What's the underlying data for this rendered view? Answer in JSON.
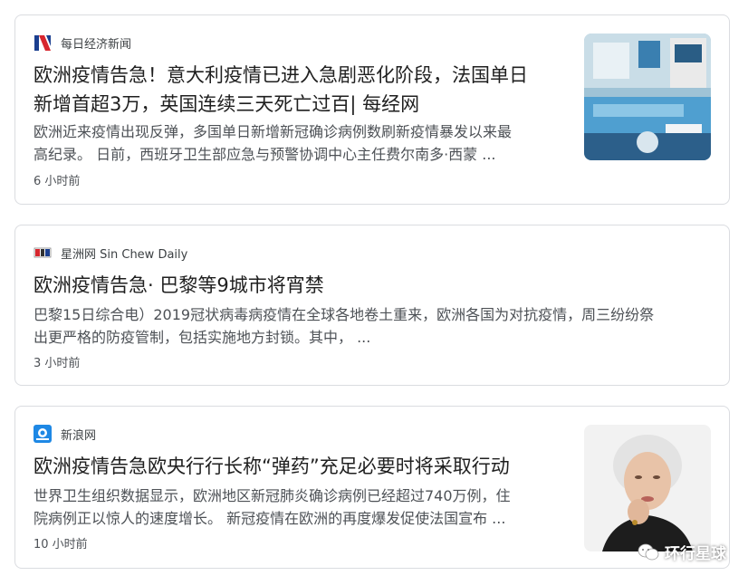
{
  "results": [
    {
      "source": "每日经济新闻",
      "title_line1": "欧洲疫情告急！意大利疫情已进入急剧恶化阶段，法国单日",
      "title_line2": "新增首超3万，英国连续三天死亡过百| 每经网",
      "snippet_line1": "欧洲近来疫情出现反弹，多国单日新增新冠确诊病例数刷新疫情暴发以来最",
      "snippet_line2": "高纪录。 日前，西班牙卫生部应急与预警协调中心主任费尔南多·西蒙 ...",
      "time": "6 小时前",
      "logo_icon": "nbd-logo-icon",
      "thumbnail": "hospital-icu-photo"
    },
    {
      "source": "星洲网 Sin Chew Daily",
      "title_line1": "欧洲疫情告急· 巴黎等9城市将宵禁",
      "snippet_line1": "巴黎15日综合电）2019冠状病毒病疫情在全球各地卷土重来，欧洲各国为对抗疫情，周三纷纷祭",
      "snippet_line2": "出更严格的防疫管制，包括实施地方封锁。其中，  ...",
      "time": "3 小时前",
      "logo_icon": "sinchew-logo-icon"
    },
    {
      "source": "新浪网",
      "title_line1": "欧洲疫情告急欧央行行长称“弹药”充足必要时将采取行动",
      "snippet_line1": "世界卫生组织数据显示，欧洲地区新冠肺炎确诊病例已经超过740万例，住",
      "snippet_line2": "院病例正以惊人的速度增长。 新冠疫情在欧洲的再度爆发促使法国宣布 ...",
      "time": "10 小时前",
      "logo_icon": "sina-logo-icon",
      "thumbnail": "lagarde-portrait-photo"
    }
  ],
  "watermark": "环行星球"
}
